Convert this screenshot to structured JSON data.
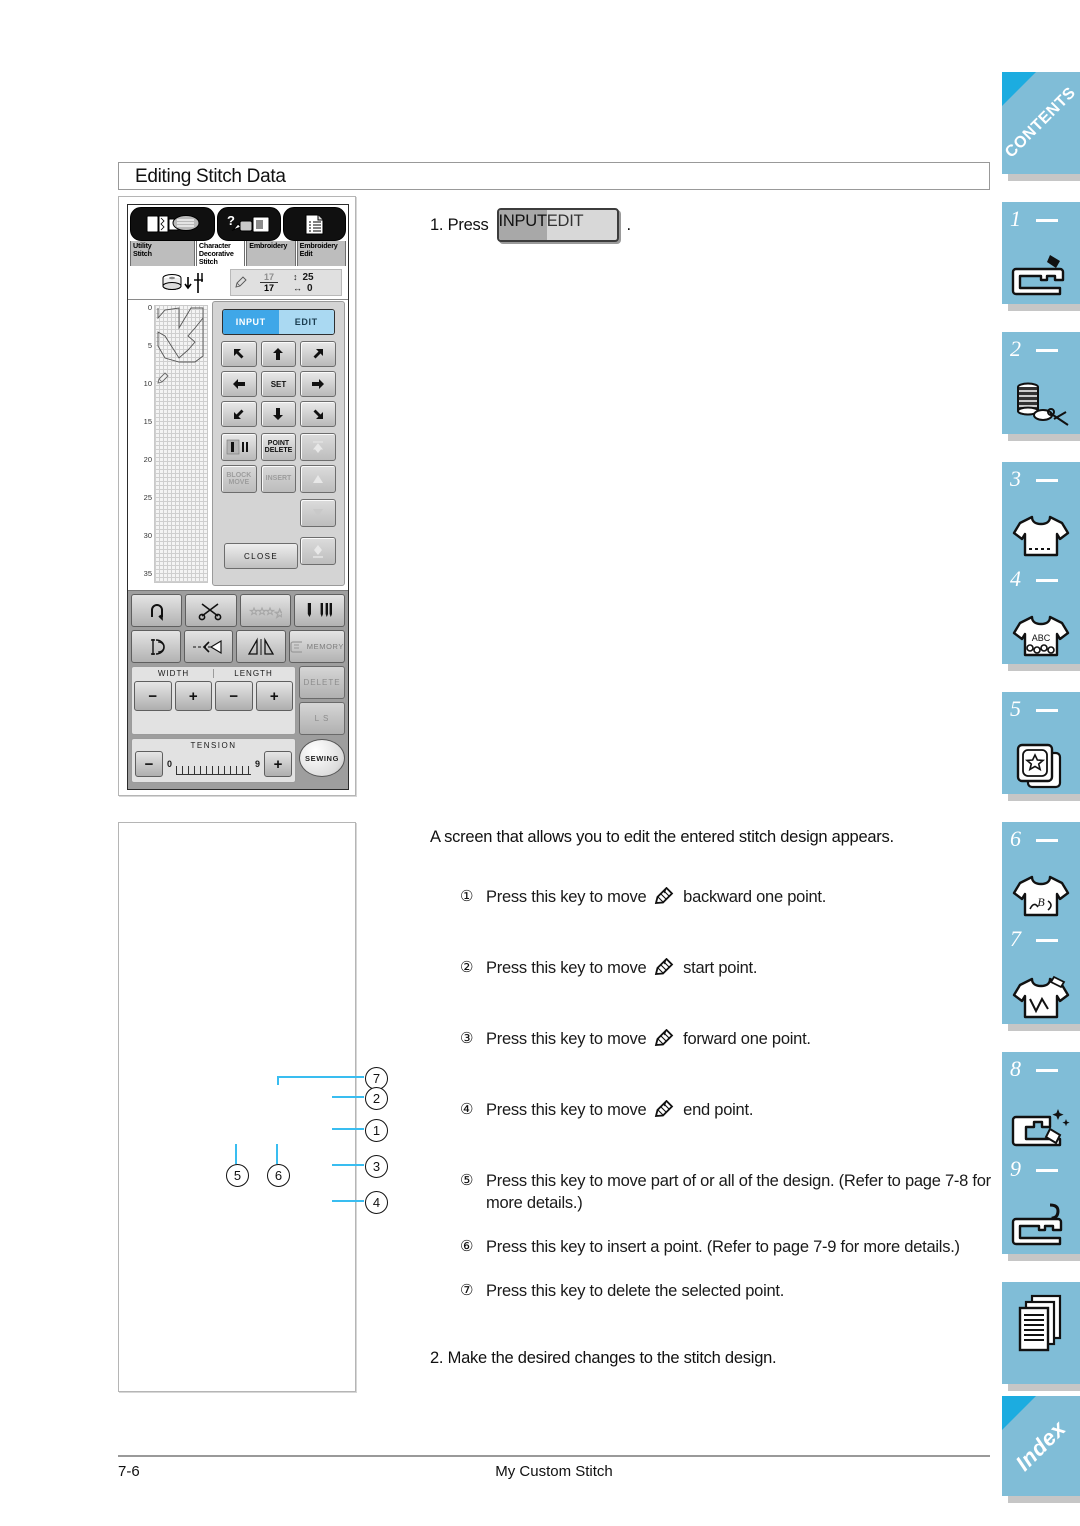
{
  "section": {
    "title": "Editing Stitch Data"
  },
  "machine_screen": {
    "tabs": [
      {
        "label": "Utility\nStitch",
        "icon": "utility-stitch-icon",
        "active": false
      },
      {
        "label": "Character\nDecorative\nStitch",
        "icon": "character-decorative-stitch-icon",
        "active": true
      },
      {
        "label": "Embroidery",
        "icon": "embroidery-icon",
        "active": false
      },
      {
        "label": "Embroidery\nEdit",
        "icon": "embroidery-edit-icon",
        "active": false
      }
    ],
    "status": {
      "point_current": "17",
      "point_total": "17",
      "vertical_value": "25",
      "horizontal_value": "0"
    },
    "ruler_labels": [
      "0",
      "5",
      "10",
      "15",
      "20",
      "25",
      "30",
      "35"
    ],
    "mode_toggle": {
      "input": "INPUT",
      "edit": "EDIT",
      "selected": "INPUT"
    },
    "direction_keys": [
      "arrow-up-left",
      "arrow-up",
      "arrow-up-right",
      "arrow-left",
      "SET",
      "arrow-right",
      "arrow-down-left",
      "arrow-down",
      "arrow-down-right"
    ],
    "set_label": "SET",
    "edit_keys": {
      "single_double": "single-double-stitch-icon",
      "point_delete": "POINT\nDELETE",
      "block_move": "BLOCK\nMOVE",
      "insert": "INSERT",
      "close": "CLOSE"
    },
    "nav_keys": [
      "jump-to-start",
      "step-back",
      "step-forward",
      "jump-to-end"
    ],
    "function_keys_row1": [
      "reverse-stitch-icon",
      "thread-cutter-icon",
      "auto-threading-icon",
      "needle-mode-icon"
    ],
    "function_keys_row2": [
      "stitch-length-icon",
      "mirror-image-icon",
      "taper-icon",
      "MEMORY"
    ],
    "width_label": "WIDTH",
    "length_label": "LENGTH",
    "tension_label": "TENSION",
    "tension_min": "0",
    "tension_max": "9",
    "minus": "−",
    "plus": "+",
    "delete_label": "DELETE",
    "ls_label": "L  S",
    "sewing_label": "SEWING"
  },
  "steps": {
    "step1_prefix": "1.  Press",
    "step1_toggle": {
      "input": "INPUT",
      "edit": "EDIT"
    },
    "step1_suffix": ".",
    "intro": "A screen that allows you to edit the entered stitch design appears.",
    "items": [
      {
        "marker": "①",
        "text_before": "Press this key to move",
        "icon": "stylus-pen-icon",
        "text_after": "backward one point."
      },
      {
        "marker": "②",
        "text_before": "Press this key to move",
        "icon": "stylus-pen-icon",
        "text_after": "start point."
      },
      {
        "marker": "③",
        "text_before": "Press this key to move",
        "icon": "stylus-pen-icon",
        "text_after": "forward one point."
      },
      {
        "marker": "④",
        "text_before": "Press this key to move",
        "icon": "stylus-pen-icon",
        "text_after": "end point."
      },
      {
        "marker": "⑤",
        "text_before": "",
        "icon": "",
        "text_after": "Press this key to move part of or all of the design. (Refer to page 7-8 for more details.)"
      },
      {
        "marker": "⑥",
        "text_before": "",
        "icon": "",
        "text_after": "Press this key to insert a point. (Refer to page 7-9 for more details.)"
      },
      {
        "marker": "⑦",
        "text_before": "",
        "icon": "",
        "text_after": "Press this key to delete the selected point."
      }
    ],
    "step2": "2.  Make the desired changes to the stitch design."
  },
  "callouts": {
    "line_color": "#39bdf0",
    "markers": [
      "7",
      "2",
      "1",
      "3",
      "4",
      "5",
      "6"
    ]
  },
  "index_tabs": [
    {
      "num": "",
      "word": "CONTENTS",
      "icon": "",
      "corner": true
    },
    {
      "num": "1",
      "word": "",
      "icon": "sewing-machine-icon",
      "corner": false
    },
    {
      "num": "2",
      "word": "",
      "icon": "thread-spool-scissors-icon",
      "corner": false
    },
    {
      "num": "3",
      "word": "",
      "icon": "tshirt-icon",
      "corner": false
    },
    {
      "num": "4",
      "word": "",
      "icon": "tshirt-abc-icon",
      "corner": false
    },
    {
      "num": "5",
      "word": "",
      "icon": "embroidery-card-icon",
      "corner": false
    },
    {
      "num": "6",
      "word": "",
      "icon": "tshirt-monogram-icon",
      "corner": false
    },
    {
      "num": "7",
      "word": "",
      "icon": "tshirt-custom-stitch-icon",
      "corner": false
    },
    {
      "num": "8",
      "word": "",
      "icon": "machine-maintenance-icon",
      "corner": false
    },
    {
      "num": "9",
      "word": "",
      "icon": "machine-help-icon",
      "corner": false
    },
    {
      "num": "",
      "word": "",
      "icon": "documents-icon",
      "corner": false
    },
    {
      "num": "",
      "word": "Index",
      "icon": "",
      "corner": true
    }
  ],
  "footer": {
    "page_number": "7-6",
    "chapter_title": "My Custom Stitch"
  },
  "colors": {
    "tab_blue": "#80bdd7",
    "tab_corner_blue": "#1cace0",
    "callout_blue": "#39bdf0",
    "toggle_active": "#3fa7e8"
  }
}
